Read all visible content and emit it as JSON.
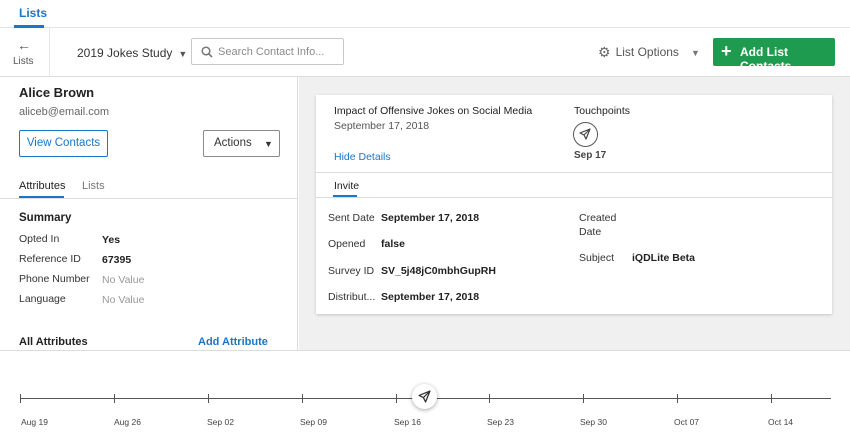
{
  "nav": {
    "tab_label": "Lists"
  },
  "toolbar": {
    "back_label": "Lists",
    "study_name": "2019 Jokes Study",
    "search_placeholder": "Search Contact Info...",
    "list_options_label": "List Options",
    "add_button_label": "Add List Contacts"
  },
  "contact": {
    "name": "Alice Brown",
    "email": "aliceb@email.com",
    "view_contacts_label": "View Contacts",
    "actions_label": "Actions"
  },
  "left_tabs": {
    "attributes": "Attributes",
    "lists": "Lists"
  },
  "summary": {
    "heading": "Summary",
    "rows": [
      {
        "label": "Opted In",
        "value": "Yes"
      },
      {
        "label": "Reference ID",
        "value": "67395"
      },
      {
        "label": "Phone Number",
        "value": "No Value"
      },
      {
        "label": "Language",
        "value": "No Value"
      }
    ]
  },
  "all_attributes": {
    "heading": "All Attributes",
    "add_label": "Add Attribute"
  },
  "card": {
    "title": "Impact of Offensive Jokes on Social Media",
    "date": "September 17, 2018",
    "hide_details": "Hide Details",
    "touchpoints_label": "Touchpoints",
    "touchpoint_date": "Sep 17",
    "tab_label": "Invite",
    "details_left": [
      {
        "label": "Sent Date",
        "value": "September 17, 2018"
      },
      {
        "label": "Opened",
        "value": "false"
      },
      {
        "label": "Survey ID",
        "value": "SV_5j48jC0mbhGupRH"
      },
      {
        "label": "Distribut...",
        "value": "September 17, 2018"
      }
    ],
    "details_right": [
      {
        "label": "Created Date",
        "value": ""
      },
      {
        "label": "Subject",
        "value": "iQDLite Beta"
      }
    ]
  },
  "timeline": {
    "labels": [
      "Aug 19",
      "Aug 26",
      "Sep 02",
      "Sep 09",
      "Sep 16",
      "Sep 23",
      "Sep 30",
      "Oct 07",
      "Oct 14"
    ]
  },
  "colors": {
    "accent": "#1a76c8",
    "primary_button": "#1e9b4e",
    "panel_background": "#f0f0f0"
  },
  "icons": [
    "arrow-left-icon",
    "chevron-down-icon",
    "search-icon",
    "gear-icon",
    "plus-icon",
    "paper-plane-icon"
  ]
}
